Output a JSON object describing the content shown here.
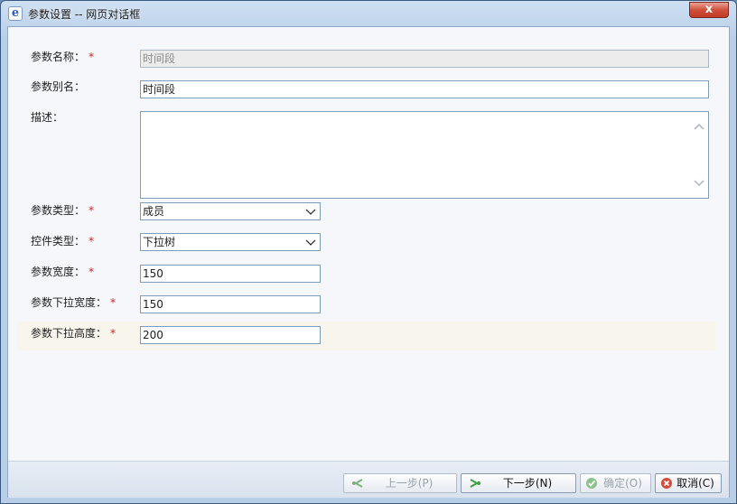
{
  "window": {
    "title": "参数设置 -- 网页对话框",
    "close_glyph": "x"
  },
  "form": {
    "param_name": {
      "label": "参数名称：",
      "value": "时间段",
      "required": true
    },
    "param_alias": {
      "label": "参数别名：",
      "value": "时间段"
    },
    "description": {
      "label": "描述：",
      "value": ""
    },
    "param_type": {
      "label": "参数类型：",
      "value": "成员",
      "required": true
    },
    "control_type": {
      "label": "控件类型：",
      "value": "下拉树",
      "required": true
    },
    "param_width": {
      "label": "参数宽度：",
      "value": "150",
      "required": true
    },
    "dropdown_width": {
      "label": "参数下拉宽度：",
      "value": "150",
      "required": true
    },
    "dropdown_height": {
      "label": "参数下拉高度：",
      "value": "200",
      "required": true
    },
    "required_mark": "*"
  },
  "buttons": {
    "prev": {
      "label": "上一步(P)",
      "enabled": false,
      "icon": "prev-arrow-icon"
    },
    "next": {
      "label": "下一步(N)",
      "enabled": true,
      "icon": "next-arrow-icon"
    },
    "ok": {
      "label": "确定(O)",
      "enabled": false,
      "icon": "check-icon"
    },
    "cancel": {
      "label": "取消(C)",
      "enabled": true,
      "icon": "cancel-icon"
    }
  },
  "colors": {
    "required": "#d42020",
    "green_icon": "#3aa23a",
    "cancel_icon": "#d84a3a"
  }
}
